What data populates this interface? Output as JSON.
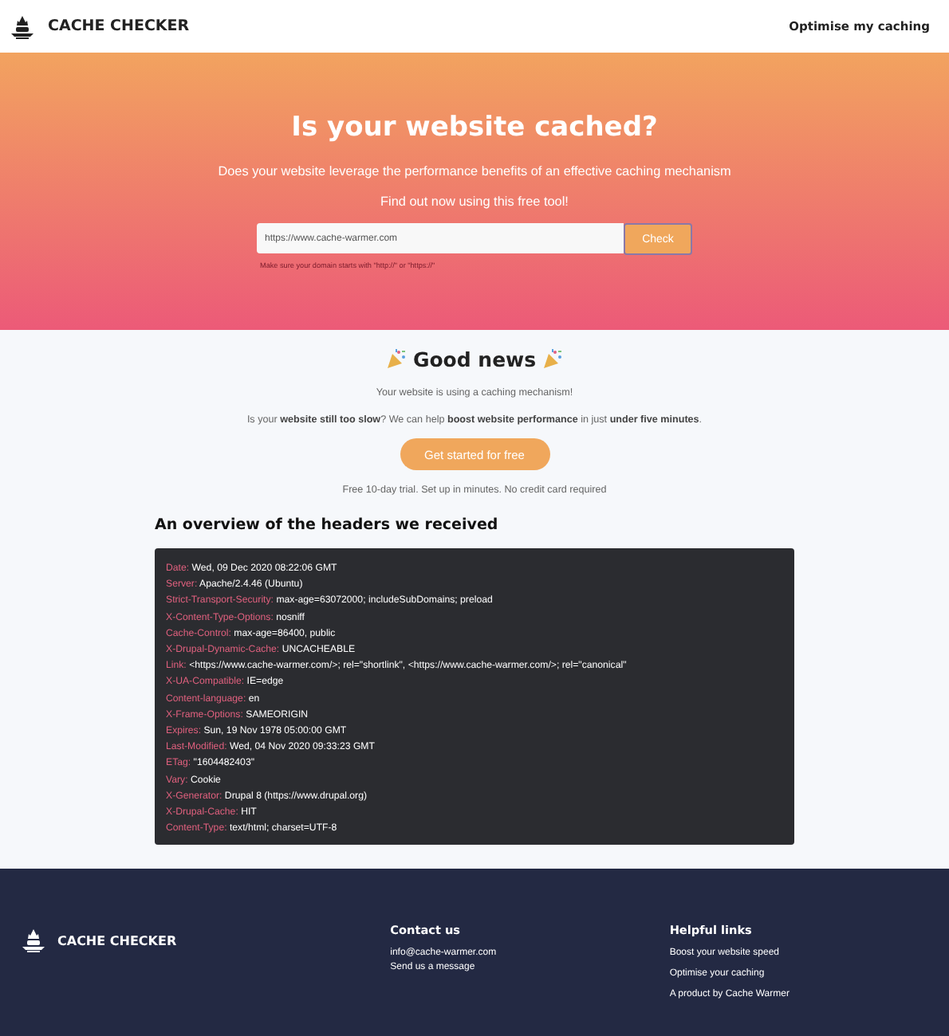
{
  "header": {
    "brand": "CACHE CHECKER",
    "nav_link": "Optimise my caching"
  },
  "hero": {
    "title": "Is your website cached?",
    "subtitle": "Does your website leverage the performance benefits of an effective caching mechanism",
    "tagline": "Find out now using this free tool!",
    "url_field": {
      "value": "https://www.cache-warmer.com"
    },
    "check_button": "Check",
    "hint": "Make sure your domain starts with \"http://\" or \"https://\""
  },
  "result": {
    "title": "Good news",
    "status": "Your website is using a caching mechanism!",
    "pitch": "Is your **website still too slow**? We can help **boost website performance** in just **under five minutes**.",
    "cta_button": "Get started for free",
    "trial_note": "Free 10-day trial. Set up in minutes. No credit card required"
  },
  "headers_section": {
    "heading": "An overview of the headers we received",
    "headers": [
      {
        "name": "Date:",
        "value": "Wed, 09 Dec 2020 08:22:06 GMT"
      },
      {
        "name": "Server:",
        "value": "Apache/2.4.46 (Ubuntu)"
      },
      {
        "name": "Strict-Transport-Security:",
        "value": "max-age=63072000; includeSubDomains; preload"
      },
      {
        "name": "X-Content-Type-Options:",
        "value": "nosniff"
      },
      {
        "name": "Cache-Control:",
        "value": "max-age=86400, public"
      },
      {
        "name": "X-Drupal-Dynamic-Cache:",
        "value": "UNCACHEABLE"
      },
      {
        "name": "Link:",
        "value": "<https://www.cache-warmer.com/>; rel=\"shortlink\", <https://www.cache-warmer.com/>; rel=\"canonical\""
      },
      {
        "name": "X-UA-Compatible:",
        "value": "IE=edge"
      },
      {
        "name": "Content-language:",
        "value": "en"
      },
      {
        "name": "X-Frame-Options:",
        "value": "SAMEORIGIN"
      },
      {
        "name": "Expires:",
        "value": "Sun, 19 Nov 1978 05:00:00 GMT"
      },
      {
        "name": "Last-Modified:",
        "value": "Wed, 04 Nov 2020 09:33:23 GMT"
      },
      {
        "name": "ETag:",
        "value": "\"1604482403\""
      },
      {
        "name": "Vary:",
        "value": "Cookie"
      },
      {
        "name": "X-Generator:",
        "value": "Drupal 8 (https://www.drupal.org)"
      },
      {
        "name": "X-Drupal-Cache:",
        "value": "HIT"
      },
      {
        "name": "Content-Type:",
        "value": "text/html; charset=UTF-8"
      }
    ]
  },
  "footer": {
    "brand": "CACHE CHECKER",
    "contact": {
      "heading": "Contact us",
      "links": [
        "info@cache-warmer.com",
        "Send us a message"
      ]
    },
    "helpful": {
      "heading": "Helpful links",
      "links": [
        "Boost your website speed",
        "Optimise your caching",
        "A product by Cache Warmer"
      ]
    }
  }
}
